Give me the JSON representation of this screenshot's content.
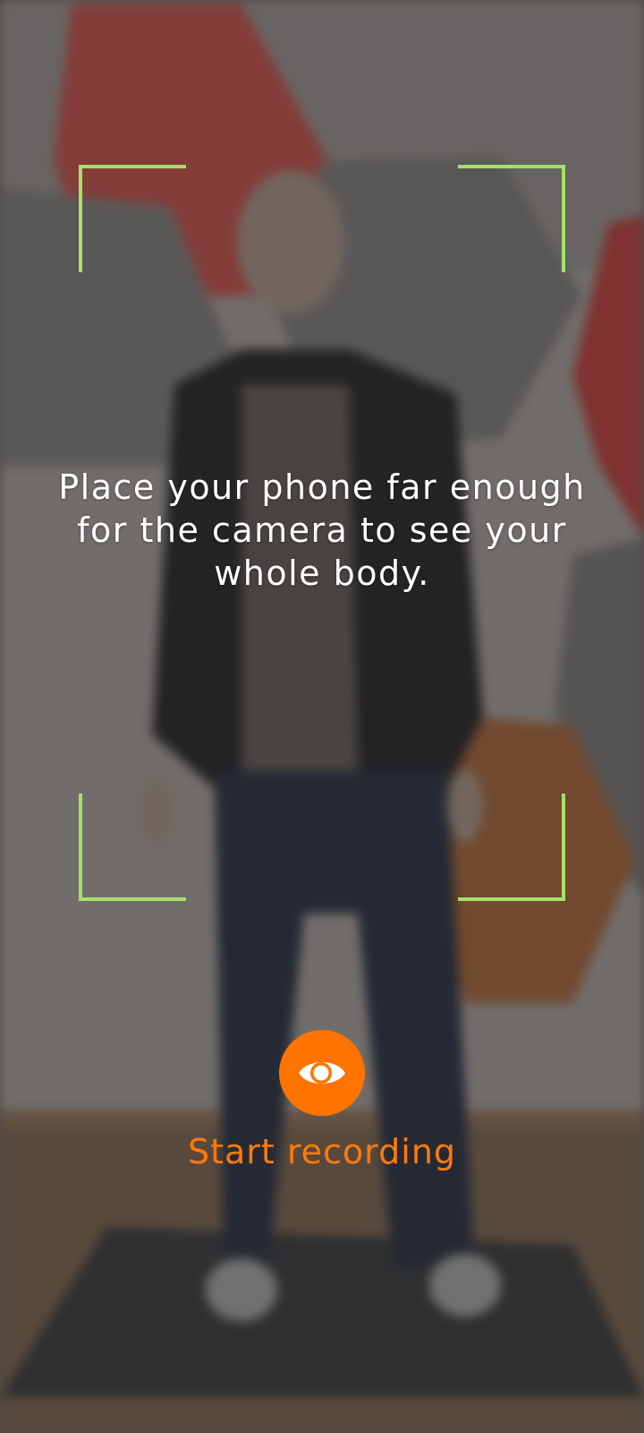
{
  "instruction": {
    "text": "Place your phone far enough for the camera to see your whole body."
  },
  "record": {
    "label": "Start recording",
    "icon": "eye-icon",
    "accent_color": "#ff7300"
  },
  "frame": {
    "bracket_color": "#a6e06a"
  }
}
